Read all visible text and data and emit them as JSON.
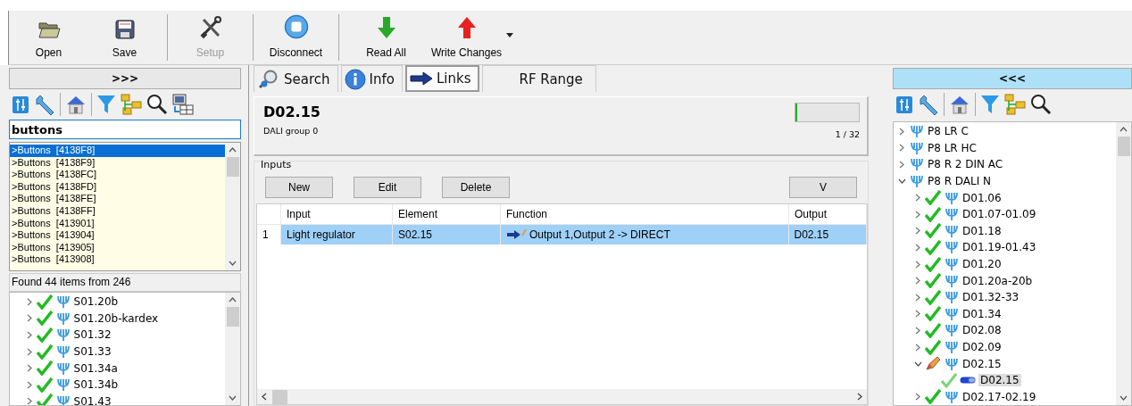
{
  "toolbar": {
    "groups": [
      [
        {
          "label": "Open",
          "disabled": false
        },
        {
          "label": "Save",
          "disabled": false
        }
      ],
      [
        {
          "label": "Setup",
          "disabled": true
        }
      ],
      [
        {
          "label": "Disconnect",
          "disabled": false
        }
      ],
      [
        {
          "label": "Read All",
          "disabled": false
        },
        {
          "label": "Write Changes",
          "disabled": false
        }
      ]
    ]
  },
  "left_panel": {
    "toggle": ">>>",
    "search": {
      "value": "buttons"
    },
    "results": [
      {
        "text": ">Buttons  [4138F8]",
        "selected": true
      },
      {
        "text": ">Buttons  [4138F9]",
        "selected": false
      },
      {
        "text": ">Buttons  [4138FC]",
        "selected": false
      },
      {
        "text": ">Buttons  [4138FD]",
        "selected": false
      },
      {
        "text": ">Buttons  [4138FE]",
        "selected": false
      },
      {
        "text": ">Buttons  [4138FF]",
        "selected": false
      },
      {
        "text": ">Buttons  [413901]",
        "selected": false
      },
      {
        "text": ">Buttons  [413904]",
        "selected": false
      },
      {
        "text": ">Buttons  [413905]",
        "selected": false
      },
      {
        "text": ">Buttons  [413908]",
        "selected": false
      }
    ],
    "status": "Found 44 items from 246",
    "tree": [
      {
        "label": "S01.20b",
        "expanded": false,
        "kind": "checked",
        "selected": false
      },
      {
        "label": "S01.20b-kardex",
        "expanded": false,
        "kind": "checked",
        "selected": false
      },
      {
        "label": "S01.32",
        "expanded": false,
        "kind": "checked",
        "selected": false
      },
      {
        "label": "S01.33",
        "expanded": false,
        "kind": "checked",
        "selected": false
      },
      {
        "label": "S01.34a",
        "expanded": false,
        "kind": "checked",
        "selected": false
      },
      {
        "label": "S01.34b",
        "expanded": false,
        "kind": "checked",
        "selected": false
      },
      {
        "label": "S01.43",
        "expanded": false,
        "kind": "checked",
        "selected": false
      }
    ]
  },
  "tabs": [
    {
      "label": "Search",
      "selected": false
    },
    {
      "label": "Info",
      "selected": false
    },
    {
      "label": "Links",
      "selected": true
    },
    {
      "label": "RF Range",
      "selected": false
    }
  ],
  "header": {
    "title": "D02.15",
    "subtitle": "DALI group 0",
    "progress": {
      "level": 0.03,
      "reading": "1 / 32"
    }
  },
  "inputs": {
    "title": "Inputs",
    "buttons": [
      "New",
      "Edit",
      "Delete"
    ],
    "side_button": "V",
    "table": {
      "columns": [
        "Input",
        "Element",
        "Function",
        "Output"
      ],
      "rows": [
        {
          "number": "1",
          "selected": true,
          "cells": [
            "Light regulator",
            "S02.15",
            "Output 1,Output 2 -> DIRECT",
            "D02.15"
          ]
        }
      ]
    }
  },
  "right_panel": {
    "toggle": "<<<",
    "tree": [
      {
        "label": "P8 LR C",
        "expanded": false,
        "selected": false
      },
      {
        "label": "P8 LR HC",
        "expanded": false,
        "selected": false
      },
      {
        "label": "P8 R 2 DIN AC",
        "expanded": false,
        "selected": false
      },
      {
        "label": "P8 R DALI N",
        "expanded": true,
        "selected": false,
        "children": [
          {
            "label": "D01.06",
            "expanded": false,
            "kind": "checked",
            "selected": false
          },
          {
            "label": "D01.07-01.09",
            "expanded": false,
            "kind": "checked",
            "selected": false
          },
          {
            "label": "D01.18",
            "expanded": false,
            "kind": "checked",
            "selected": false
          },
          {
            "label": "D01.19-01.43",
            "expanded": false,
            "kind": "checked",
            "selected": false
          },
          {
            "label": "D01.20",
            "expanded": false,
            "kind": "checked",
            "selected": false
          },
          {
            "label": "D01.20a-20b",
            "expanded": false,
            "kind": "checked",
            "selected": false
          },
          {
            "label": "D01.32-33",
            "expanded": false,
            "kind": "checked",
            "selected": false
          },
          {
            "label": "D01.34",
            "expanded": false,
            "kind": "checked",
            "selected": false
          },
          {
            "label": "D02.08",
            "expanded": false,
            "kind": "checked",
            "selected": false
          },
          {
            "label": "D02.09",
            "expanded": false,
            "kind": "checked",
            "selected": false
          },
          {
            "label": "D02.15",
            "expanded": true,
            "kind": "edited",
            "selected": false,
            "children": [
              {
                "label": "D02.15",
                "kind": "channel",
                "selected": true
              }
            ]
          },
          {
            "label": "D02.17-02.19",
            "expanded": false,
            "kind": "checked",
            "selected": false
          }
        ]
      }
    ]
  }
}
